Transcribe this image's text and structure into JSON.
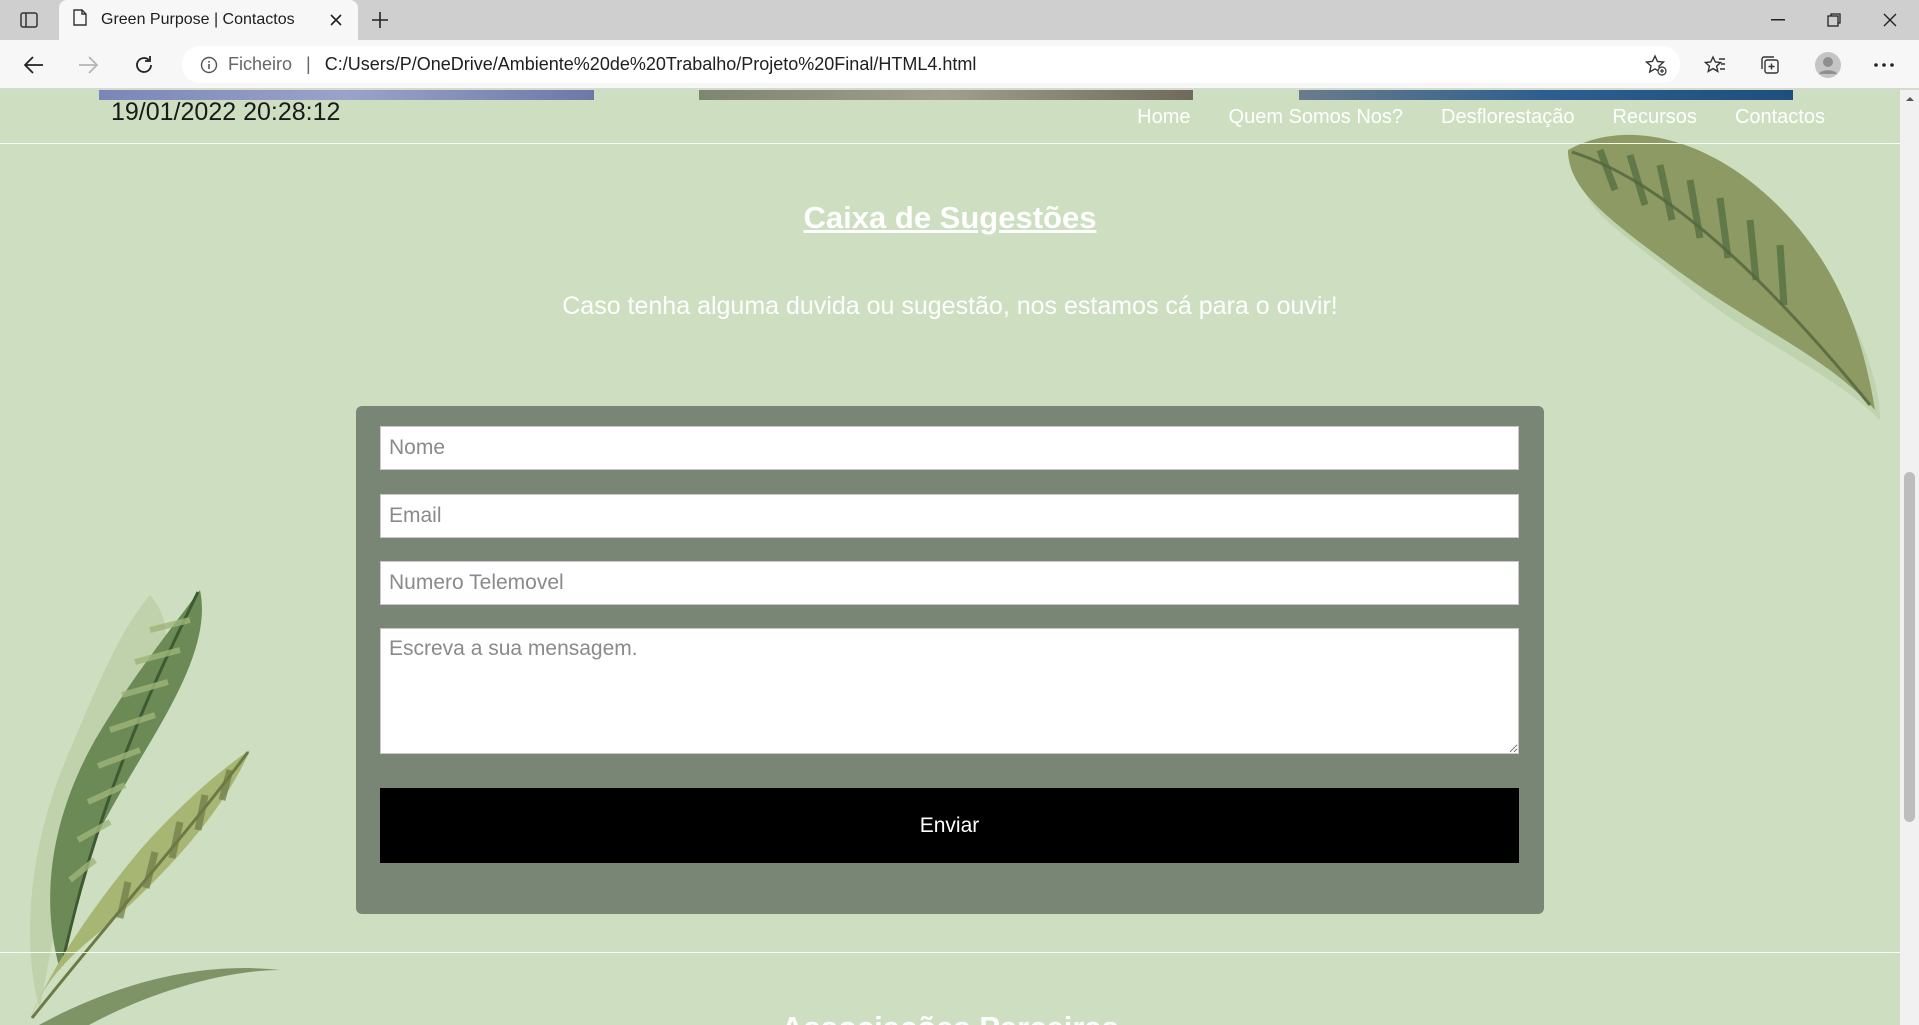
{
  "browser": {
    "tab_title": "Green Purpose | Contactos",
    "address_scheme": "Ficheiro",
    "address_separator": "|",
    "address_url": "C:/Users/P/OneDrive/Ambiente%20de%20Trabalho/Projeto%20Final/HTML4.html",
    "icons": [
      "tab-actions-icon",
      "page-icon",
      "close-icon",
      "plus-icon",
      "minimize-icon",
      "restore-icon",
      "close-window-icon",
      "back-icon",
      "forward-icon",
      "refresh-icon",
      "info-icon",
      "add-favorite-icon",
      "favorites-icon",
      "collections-icon",
      "profile-icon",
      "more-icon"
    ]
  },
  "header": {
    "datetime": "19/01/2022 20:28:12",
    "nav": [
      {
        "label": "Home"
      },
      {
        "label": "Quem Somos Nos?"
      },
      {
        "label": "Desflorestação"
      },
      {
        "label": "Recursos"
      },
      {
        "label": "Contactos"
      }
    ]
  },
  "suggestions": {
    "title": "Caixa de Sugestões",
    "subtitle": "Caso tenha alguma duvida ou sugestão, nos estamos cá para o ouvir!",
    "form": {
      "name_placeholder": "Nome",
      "email_placeholder": "Email",
      "phone_placeholder": "Numero Telemovel",
      "message_placeholder": "Escreva a sua mensagem.",
      "submit_label": "Enviar"
    }
  },
  "next_section": {
    "title": "Associações Parceiras"
  },
  "colors": {
    "page_bg": "#cddfc0",
    "form_bg": "#7a8675",
    "button_bg": "#000000",
    "text_light": "#ffffff"
  }
}
